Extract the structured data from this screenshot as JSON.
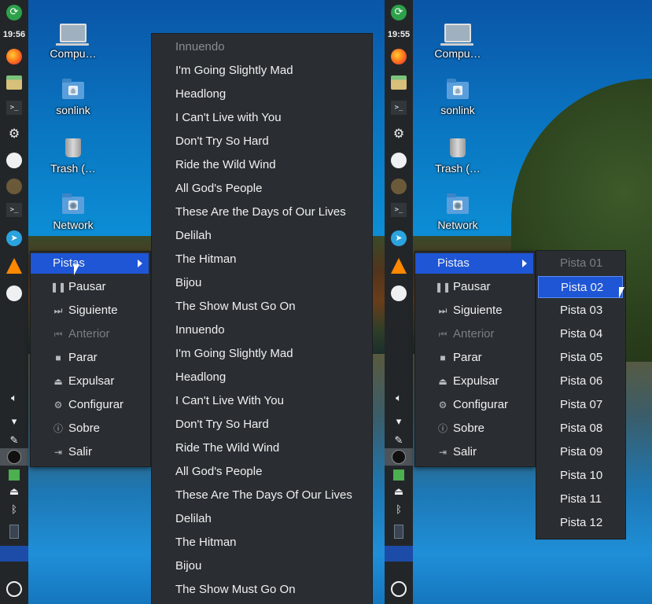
{
  "left": {
    "clock": "19:56",
    "desktop_icons": [
      {
        "name": "computer",
        "label": "Compu…"
      },
      {
        "name": "sonlink",
        "label": "sonlink"
      },
      {
        "name": "trash",
        "label": "Trash (…"
      },
      {
        "name": "network",
        "label": "Network"
      }
    ],
    "context_menu": [
      {
        "label": "Pistas",
        "icon": "submenu",
        "state": "selected"
      },
      {
        "label": "Pausar",
        "icon": "pause-icon"
      },
      {
        "label": "Siguiente",
        "icon": "skip-forward-icon"
      },
      {
        "label": "Anterior",
        "icon": "skip-back-icon",
        "state": "disabled"
      },
      {
        "label": "Parar",
        "icon": "stop-icon"
      },
      {
        "label": "Expulsar",
        "icon": "eject-icon"
      },
      {
        "label": "Configurar",
        "icon": "gear-icon"
      },
      {
        "label": "Sobre",
        "icon": "info-icon"
      },
      {
        "label": "Salir",
        "icon": "exit-icon"
      }
    ],
    "tracks_submenu": [
      {
        "label": "Innuendo",
        "state": "disabled"
      },
      {
        "label": "I'm Going Slightly Mad"
      },
      {
        "label": "Headlong"
      },
      {
        "label": "I Can't Live with You"
      },
      {
        "label": "Don't Try So Hard"
      },
      {
        "label": "Ride the Wild Wind"
      },
      {
        "label": "All God's People"
      },
      {
        "label": "These Are the Days of Our Lives"
      },
      {
        "label": "Delilah"
      },
      {
        "label": "The Hitman"
      },
      {
        "label": "Bijou"
      },
      {
        "label": "The Show Must Go On"
      },
      {
        "label": "Innuendo"
      },
      {
        "label": "I'm Going Slightly Mad"
      },
      {
        "label": "Headlong"
      },
      {
        "label": "I Can't Live With You"
      },
      {
        "label": "Don't Try So Hard"
      },
      {
        "label": "Ride The Wild Wind"
      },
      {
        "label": "All God's People"
      },
      {
        "label": "These Are The Days Of Our Lives"
      },
      {
        "label": "Delilah"
      },
      {
        "label": "The Hitman"
      },
      {
        "label": "Bijou"
      },
      {
        "label": "The Show Must Go On"
      }
    ]
  },
  "right": {
    "clock": "19:55",
    "desktop_icons": [
      {
        "name": "computer",
        "label": "Compu…"
      },
      {
        "name": "sonlink",
        "label": "sonlink"
      },
      {
        "name": "trash",
        "label": "Trash (…"
      },
      {
        "name": "network",
        "label": "Network"
      }
    ],
    "context_menu": [
      {
        "label": "Pistas",
        "icon": "submenu",
        "state": "selected"
      },
      {
        "label": "Pausar",
        "icon": "pause-icon"
      },
      {
        "label": "Siguiente",
        "icon": "skip-forward-icon"
      },
      {
        "label": "Anterior",
        "icon": "skip-back-icon",
        "state": "disabled"
      },
      {
        "label": "Parar",
        "icon": "stop-icon"
      },
      {
        "label": "Expulsar",
        "icon": "eject-icon"
      },
      {
        "label": "Configurar",
        "icon": "gear-icon"
      },
      {
        "label": "Sobre",
        "icon": "info-icon"
      },
      {
        "label": "Salir",
        "icon": "exit-icon"
      }
    ],
    "tracks_submenu": [
      {
        "label": "Pista 01",
        "state": "disabled"
      },
      {
        "label": "Pista 02",
        "state": "selected"
      },
      {
        "label": "Pista 03"
      },
      {
        "label": "Pista 04"
      },
      {
        "label": "Pista 05"
      },
      {
        "label": "Pista 06"
      },
      {
        "label": "Pista 07"
      },
      {
        "label": "Pista 08"
      },
      {
        "label": "Pista 09"
      },
      {
        "label": "Pista 10"
      },
      {
        "label": "Pista 11"
      },
      {
        "label": "Pista 12"
      }
    ]
  },
  "panel_icons": [
    "logout-icon",
    "firefox-icon",
    "file-manager-icon",
    "terminal-icon",
    "settings-icon",
    "ghost-icon",
    "gimp-icon",
    "terminal-icon",
    "telegram-icon",
    "vlc-icon",
    "ghost-icon",
    "volume-icon",
    "wifi-icon",
    "clip-icon",
    "media-icon",
    "cube-icon",
    "eject-icon",
    "bluetooth-icon",
    "battery-icon",
    "plasma-icon"
  ],
  "colors": {
    "panel": "#232629",
    "menu": "#2a2e32",
    "highlight": "#1e56d6",
    "text": "#eff0f1",
    "disabled": "#7b7e82"
  }
}
